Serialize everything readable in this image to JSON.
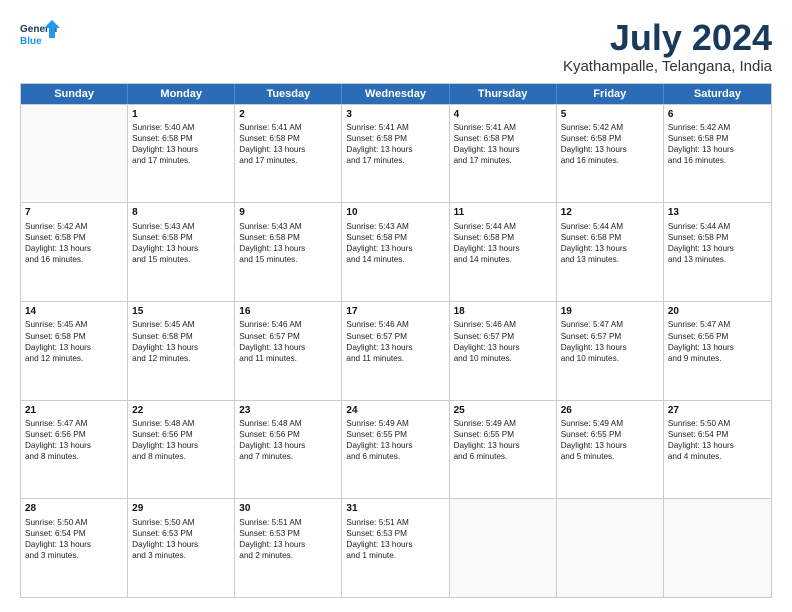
{
  "logo": {
    "line1": "General",
    "line2": "Blue"
  },
  "title": "July 2024",
  "subtitle": "Kyathampalle, Telangana, India",
  "headers": [
    "Sunday",
    "Monday",
    "Tuesday",
    "Wednesday",
    "Thursday",
    "Friday",
    "Saturday"
  ],
  "weeks": [
    [
      {
        "day": "",
        "info": ""
      },
      {
        "day": "1",
        "info": "Sunrise: 5:40 AM\nSunset: 6:58 PM\nDaylight: 13 hours\nand 17 minutes."
      },
      {
        "day": "2",
        "info": "Sunrise: 5:41 AM\nSunset: 6:58 PM\nDaylight: 13 hours\nand 17 minutes."
      },
      {
        "day": "3",
        "info": "Sunrise: 5:41 AM\nSunset: 6:58 PM\nDaylight: 13 hours\nand 17 minutes."
      },
      {
        "day": "4",
        "info": "Sunrise: 5:41 AM\nSunset: 6:58 PM\nDaylight: 13 hours\nand 17 minutes."
      },
      {
        "day": "5",
        "info": "Sunrise: 5:42 AM\nSunset: 6:58 PM\nDaylight: 13 hours\nand 16 minutes."
      },
      {
        "day": "6",
        "info": "Sunrise: 5:42 AM\nSunset: 6:58 PM\nDaylight: 13 hours\nand 16 minutes."
      }
    ],
    [
      {
        "day": "7",
        "info": "Sunrise: 5:42 AM\nSunset: 6:58 PM\nDaylight: 13 hours\nand 16 minutes."
      },
      {
        "day": "8",
        "info": "Sunrise: 5:43 AM\nSunset: 6:58 PM\nDaylight: 13 hours\nand 15 minutes."
      },
      {
        "day": "9",
        "info": "Sunrise: 5:43 AM\nSunset: 6:58 PM\nDaylight: 13 hours\nand 15 minutes."
      },
      {
        "day": "10",
        "info": "Sunrise: 5:43 AM\nSunset: 6:58 PM\nDaylight: 13 hours\nand 14 minutes."
      },
      {
        "day": "11",
        "info": "Sunrise: 5:44 AM\nSunset: 6:58 PM\nDaylight: 13 hours\nand 14 minutes."
      },
      {
        "day": "12",
        "info": "Sunrise: 5:44 AM\nSunset: 6:58 PM\nDaylight: 13 hours\nand 13 minutes."
      },
      {
        "day": "13",
        "info": "Sunrise: 5:44 AM\nSunset: 6:58 PM\nDaylight: 13 hours\nand 13 minutes."
      }
    ],
    [
      {
        "day": "14",
        "info": "Sunrise: 5:45 AM\nSunset: 6:58 PM\nDaylight: 13 hours\nand 12 minutes."
      },
      {
        "day": "15",
        "info": "Sunrise: 5:45 AM\nSunset: 6:58 PM\nDaylight: 13 hours\nand 12 minutes."
      },
      {
        "day": "16",
        "info": "Sunrise: 5:46 AM\nSunset: 6:57 PM\nDaylight: 13 hours\nand 11 minutes."
      },
      {
        "day": "17",
        "info": "Sunrise: 5:46 AM\nSunset: 6:57 PM\nDaylight: 13 hours\nand 11 minutes."
      },
      {
        "day": "18",
        "info": "Sunrise: 5:46 AM\nSunset: 6:57 PM\nDaylight: 13 hours\nand 10 minutes."
      },
      {
        "day": "19",
        "info": "Sunrise: 5:47 AM\nSunset: 6:57 PM\nDaylight: 13 hours\nand 10 minutes."
      },
      {
        "day": "20",
        "info": "Sunrise: 5:47 AM\nSunset: 6:56 PM\nDaylight: 13 hours\nand 9 minutes."
      }
    ],
    [
      {
        "day": "21",
        "info": "Sunrise: 5:47 AM\nSunset: 6:56 PM\nDaylight: 13 hours\nand 8 minutes."
      },
      {
        "day": "22",
        "info": "Sunrise: 5:48 AM\nSunset: 6:56 PM\nDaylight: 13 hours\nand 8 minutes."
      },
      {
        "day": "23",
        "info": "Sunrise: 5:48 AM\nSunset: 6:56 PM\nDaylight: 13 hours\nand 7 minutes."
      },
      {
        "day": "24",
        "info": "Sunrise: 5:49 AM\nSunset: 6:55 PM\nDaylight: 13 hours\nand 6 minutes."
      },
      {
        "day": "25",
        "info": "Sunrise: 5:49 AM\nSunset: 6:55 PM\nDaylight: 13 hours\nand 6 minutes."
      },
      {
        "day": "26",
        "info": "Sunrise: 5:49 AM\nSunset: 6:55 PM\nDaylight: 13 hours\nand 5 minutes."
      },
      {
        "day": "27",
        "info": "Sunrise: 5:50 AM\nSunset: 6:54 PM\nDaylight: 13 hours\nand 4 minutes."
      }
    ],
    [
      {
        "day": "28",
        "info": "Sunrise: 5:50 AM\nSunset: 6:54 PM\nDaylight: 13 hours\nand 3 minutes."
      },
      {
        "day": "29",
        "info": "Sunrise: 5:50 AM\nSunset: 6:53 PM\nDaylight: 13 hours\nand 3 minutes."
      },
      {
        "day": "30",
        "info": "Sunrise: 5:51 AM\nSunset: 6:53 PM\nDaylight: 13 hours\nand 2 minutes."
      },
      {
        "day": "31",
        "info": "Sunrise: 5:51 AM\nSunset: 6:53 PM\nDaylight: 13 hours\nand 1 minute."
      },
      {
        "day": "",
        "info": ""
      },
      {
        "day": "",
        "info": ""
      },
      {
        "day": "",
        "info": ""
      }
    ]
  ]
}
